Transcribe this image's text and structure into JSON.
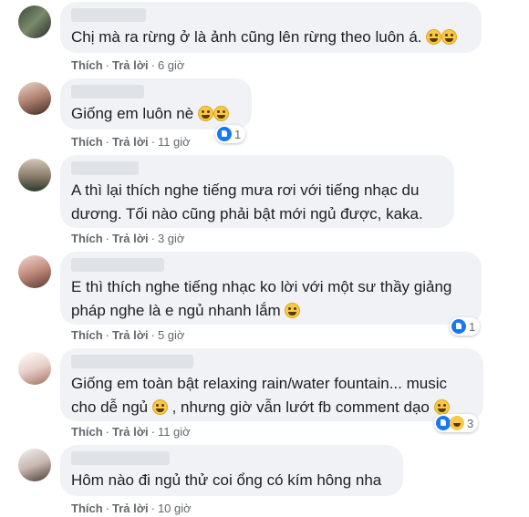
{
  "comments": [
    {
      "text": "Chị mà ra rừng ở là ảnh cũng lên rừng theo luôn á.",
      "like": "Thích",
      "reply": "Trả lời",
      "time": "6 giờ"
    },
    {
      "text": "Giống em luôn nè",
      "like": "Thích",
      "reply": "Trả lời",
      "time": "11 giờ",
      "reaction_count": "1"
    },
    {
      "text": "A thì lại thích nghe tiếng mưa rơi với tiếng nhạc du dương. Tối nào cũng phải bật mới ngủ được, kaka.",
      "like": "Thích",
      "reply": "Trả lời",
      "time": "3 giờ"
    },
    {
      "text": "E thì thích nghe tiếng nhạc ko lời với một sư thầy giảng pháp nghe là e ngủ nhanh lắm",
      "like": "Thích",
      "reply": "Trả lời",
      "time": "5 giờ",
      "reaction_count": "1"
    },
    {
      "text_1": "Giống em toàn bật relaxing rain/water fountain... music cho dễ ngủ",
      "text_2": ", nhưng giờ vẫn lướt fb comment dạo",
      "like": "Thích",
      "reply": "Trả lời",
      "time": "11 giờ",
      "reaction_count": "3"
    },
    {
      "text": "Hôm nào đi ngủ thử coi ổng có kím hông nha",
      "like": "Thích",
      "reply": "Trả lời",
      "time": "10 giờ"
    }
  ],
  "colors": {
    "bubble": "#f0f2f5",
    "like_blue": "#1877f2",
    "meta": "#65676b"
  }
}
